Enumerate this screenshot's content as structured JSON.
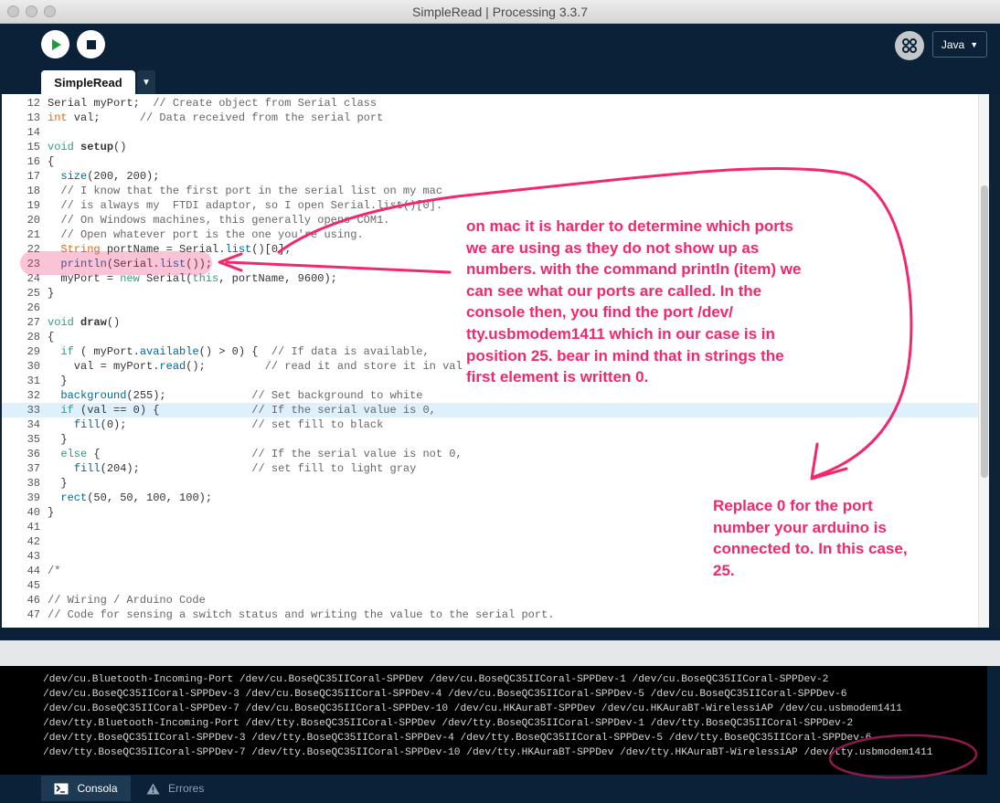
{
  "window": {
    "title": "SimpleRead | Processing 3.3.7"
  },
  "toolbar": {
    "run_icon": "play-icon",
    "stop_icon": "stop-icon",
    "mode_icon": "debug-icon",
    "mode_language": "Java",
    "language_caret": "▼"
  },
  "tabs": {
    "active": "SimpleRead",
    "menu_caret": "▼"
  },
  "editor": {
    "highlight_line": "33",
    "lines": [
      {
        "n": "12",
        "code": "Serial myPort;  // Create object from Serial class"
      },
      {
        "n": "13",
        "code": "int val;      // Data received from the serial port"
      },
      {
        "n": "14",
        "code": ""
      },
      {
        "n": "15",
        "code": "void setup()"
      },
      {
        "n": "16",
        "code": "{"
      },
      {
        "n": "17",
        "code": "  size(200, 200);"
      },
      {
        "n": "18",
        "code": "  // I know that the first port in the serial list on my mac"
      },
      {
        "n": "19",
        "code": "  // is always my  FTDI adaptor, so I open Serial.list()[0]."
      },
      {
        "n": "20",
        "code": "  // On Windows machines, this generally opens COM1."
      },
      {
        "n": "21",
        "code": "  // Open whatever port is the one you're using."
      },
      {
        "n": "22",
        "code": "  String portName = Serial.list()[0];"
      },
      {
        "n": "23",
        "code": "  println(Serial.list());"
      },
      {
        "n": "24",
        "code": "  myPort = new Serial(this, portName, 9600);"
      },
      {
        "n": "25",
        "code": "}"
      },
      {
        "n": "26",
        "code": ""
      },
      {
        "n": "27",
        "code": "void draw()"
      },
      {
        "n": "28",
        "code": "{"
      },
      {
        "n": "29",
        "code": "  if ( myPort.available() > 0) {  // If data is available,"
      },
      {
        "n": "30",
        "code": "    val = myPort.read();         // read it and store it in val"
      },
      {
        "n": "31",
        "code": "  }"
      },
      {
        "n": "32",
        "code": "  background(255);             // Set background to white"
      },
      {
        "n": "33",
        "code": "  if (val == 0) {              // If the serial value is 0,"
      },
      {
        "n": "34",
        "code": "    fill(0);                   // set fill to black"
      },
      {
        "n": "35",
        "code": "  }"
      },
      {
        "n": "36",
        "code": "  else {                       // If the serial value is not 0,"
      },
      {
        "n": "37",
        "code": "    fill(204);                 // set fill to light gray"
      },
      {
        "n": "38",
        "code": "  }"
      },
      {
        "n": "39",
        "code": "  rect(50, 50, 100, 100);"
      },
      {
        "n": "40",
        "code": "}"
      },
      {
        "n": "41",
        "code": ""
      },
      {
        "n": "42",
        "code": ""
      },
      {
        "n": "43",
        "code": ""
      },
      {
        "n": "44",
        "code": "/*"
      },
      {
        "n": "45",
        "code": ""
      },
      {
        "n": "46",
        "code": "// Wiring / Arduino Code"
      },
      {
        "n": "47",
        "code": "// Code for sensing a switch status and writing the value to the serial port."
      }
    ]
  },
  "console": {
    "lines": [
      "/dev/cu.Bluetooth-Incoming-Port /dev/cu.BoseQC35IICoral-SPPDev /dev/cu.BoseQC35IICoral-SPPDev-1 /dev/cu.BoseQC35IICoral-SPPDev-2",
      "/dev/cu.BoseQC35IICoral-SPPDev-3 /dev/cu.BoseQC35IICoral-SPPDev-4 /dev/cu.BoseQC35IICoral-SPPDev-5 /dev/cu.BoseQC35IICoral-SPPDev-6",
      "/dev/cu.BoseQC35IICoral-SPPDev-7 /dev/cu.BoseQC35IICoral-SPPDev-10 /dev/cu.HKAuraBT-SPPDev /dev/cu.HKAuraBT-WirelessiAP /dev/cu.usbmodem1411",
      "/dev/tty.Bluetooth-Incoming-Port /dev/tty.BoseQC35IICoral-SPPDev /dev/tty.BoseQC35IICoral-SPPDev-1 /dev/tty.BoseQC35IICoral-SPPDev-2",
      "/dev/tty.BoseQC35IICoral-SPPDev-3 /dev/tty.BoseQC35IICoral-SPPDev-4 /dev/tty.BoseQC35IICoral-SPPDev-5 /dev/tty.BoseQC35IICoral-SPPDev-6",
      "/dev/tty.BoseQC35IICoral-SPPDev-7 /dev/tty.BoseQC35IICoral-SPPDev-10 /dev/tty.HKAuraBT-SPPDev /dev/tty.HKAuraBT-WirelessiAP /dev/tty.usbmodem1411"
    ]
  },
  "footer": {
    "console_tab": "Consola",
    "console_icon": "terminal-icon",
    "errors_tab": "Errores",
    "errors_icon": "warning-icon"
  },
  "annotations": {
    "note1": [
      "on mac it is harder to determine which ports",
      "we are using as they do not show up as",
      "numbers. with the command println (item) we",
      "can see what our ports are called.  In the",
      "console then, you find the port /dev/",
      "tty.usbmodem1411 which in our case is in",
      "position 25. bear in mind that in strings the",
      "first element is written 0."
    ],
    "note2": [
      "Replace 0 for the port",
      "number your arduino is",
      "connected to. In this case,",
      "25."
    ]
  },
  "colors": {
    "keyword_blue": "#33997e",
    "type_orange": "#e2661a",
    "function_blue": "#006699",
    "comment_gray": "#666666",
    "annotation_pink": "#f2286a",
    "highlight_line": "#ddf0fb"
  }
}
